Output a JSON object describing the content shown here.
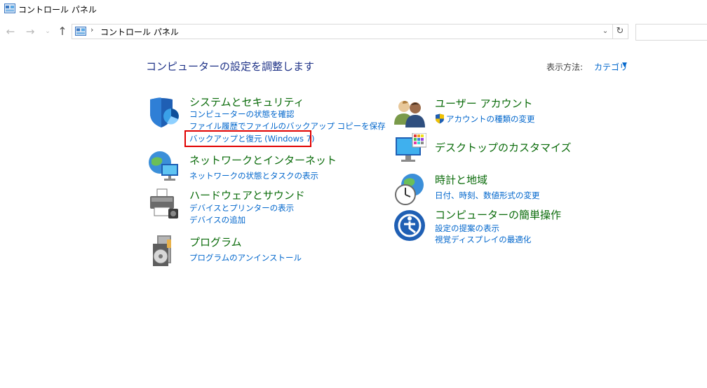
{
  "window": {
    "title": "コントロール パネル",
    "icon": "control-panel-icon"
  },
  "nav": {
    "back_icon": "←",
    "forward_icon": "→",
    "recent_icon": "⌄",
    "up_icon": "↑"
  },
  "address": {
    "sep": "›",
    "path": "コントロール パネル",
    "dropdown_icon": "⌄",
    "refresh_icon": "↻"
  },
  "search": {
    "placeholder": ""
  },
  "heading": "コンピューターの設定を調整します",
  "view_by": {
    "label": "表示方法:",
    "value": "カテゴリ",
    "caret": "▼"
  },
  "categories_left": [
    {
      "title": "システムとセキュリティ",
      "icon": "shield-icon",
      "links": [
        "コンピューターの状態を確認",
        "ファイル履歴でファイルのバックアップ コピーを保存",
        "バックアップと復元 (Windows 7)"
      ]
    },
    {
      "title": "ネットワークとインターネット",
      "icon": "network-icon",
      "links": [
        "ネットワークの状態とタスクの表示"
      ]
    },
    {
      "title": "ハードウェアとサウンド",
      "icon": "printer-icon",
      "links": [
        "デバイスとプリンターの表示",
        "デバイスの追加"
      ]
    },
    {
      "title": "プログラム",
      "icon": "programs-icon",
      "links": [
        "プログラムのアンインストール"
      ]
    }
  ],
  "categories_right": [
    {
      "title": "ユーザー アカウント",
      "icon": "users-icon",
      "links": [
        "アカウントの種類の変更"
      ]
    },
    {
      "title": "デスクトップのカスタマイズ",
      "icon": "desktop-icon",
      "links": []
    },
    {
      "title": "時計と地域",
      "icon": "clock-globe-icon",
      "links": [
        "日付、時刻、数値形式の変更"
      ]
    },
    {
      "title": "コンピューターの簡単操作",
      "icon": "accessibility-icon",
      "links": [
        "設定の提案の表示",
        "視覚ディスプレイの最適化"
      ]
    }
  ],
  "colors": {
    "heading": "#1e3287",
    "category_title": "#0a6b0a",
    "link": "#0066cc",
    "highlight": "#e00000"
  }
}
